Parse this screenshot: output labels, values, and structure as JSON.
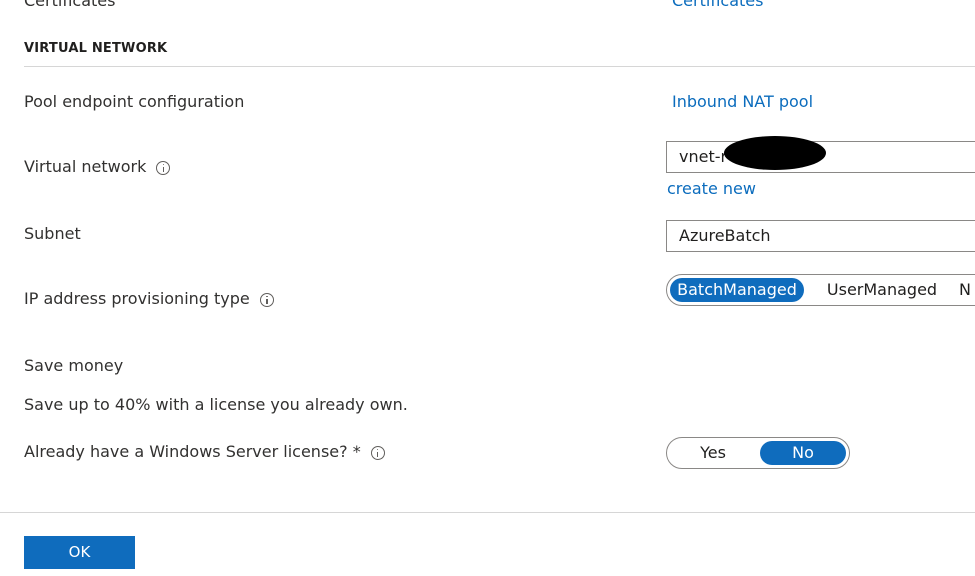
{
  "top_partial": {
    "left_label": "Certificates",
    "right_link": "Certificates"
  },
  "section": {
    "title": "VIRTUAL NETWORK"
  },
  "rows": {
    "pool_endpoint": {
      "label": "Pool endpoint configuration",
      "link": "Inbound NAT pool"
    },
    "virtual_network": {
      "label": "Virtual network",
      "value": "vnet-r",
      "create_new": "create new"
    },
    "subnet": {
      "label": "Subnet",
      "value": "AzureBatch"
    },
    "ip_provisioning": {
      "label": "IP address provisioning type",
      "options": [
        "BatchManaged",
        "UserManaged",
        "N"
      ],
      "selected": "BatchManaged"
    }
  },
  "save_money": {
    "heading": "Save money",
    "description": "Save up to 40% with a license you already own."
  },
  "windows_license": {
    "label": "Already have a Windows Server license? *",
    "options": [
      "Yes",
      "No"
    ],
    "selected": "No"
  },
  "footer": {
    "ok_label": "OK"
  },
  "colors": {
    "accent": "#0f6cbd",
    "link": "#0b6cbd",
    "text": "#323130",
    "border": "#8a8886",
    "divider": "#d6d6d6"
  }
}
